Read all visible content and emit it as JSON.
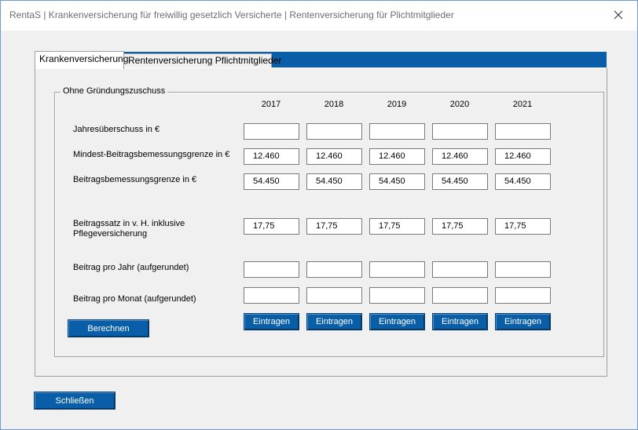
{
  "window": {
    "title": "RentaS | Krankenversicherung für freiwillig gesetzlich Versicherte | Rentenversicherung für Plichtmitglieder"
  },
  "tabs": [
    {
      "label": "Krankenversicherung",
      "active": true
    },
    {
      "label": "Rentenversicherung Pflichtmitglieder",
      "active": false
    }
  ],
  "group": {
    "title": "Ohne Gründungszuschuss"
  },
  "years": [
    "2017",
    "2018",
    "2019",
    "2020",
    "2021"
  ],
  "rows": {
    "jahresueberschuss": {
      "label": "Jahresüberschuss in €",
      "values": [
        "",
        "",
        "",
        "",
        ""
      ]
    },
    "mindest": {
      "label": "Mindest-Beitragsbemessungsgrenze in €",
      "values": [
        "12.460",
        "12.460",
        "12.460",
        "12.460",
        "12.460"
      ]
    },
    "bbg": {
      "label": "Beitragsbemessungsgrenze in €",
      "values": [
        "54.450",
        "54.450",
        "54.450",
        "54.450",
        "54.450"
      ]
    },
    "satz": {
      "label_line1": "Beitragssatz in v. H. inklusive",
      "label_line2": "Pflegeversicherung",
      "values": [
        "17,75",
        "17,75",
        "17,75",
        "17,75",
        "17,75"
      ]
    },
    "beitrag_jahr": {
      "label": "Beitrag pro Jahr (aufgerundet)",
      "values": [
        "",
        "",
        "",
        "",
        ""
      ]
    },
    "beitrag_monat": {
      "label": "Beitrag pro Monat (aufgerundet)",
      "values": [
        "",
        "",
        "",
        "",
        ""
      ]
    }
  },
  "buttons": {
    "eintragen": "Eintragen",
    "berechnen": "Berechnen",
    "schliessen": "Schließen"
  },
  "colors": {
    "accent": "#0a5ea8"
  }
}
